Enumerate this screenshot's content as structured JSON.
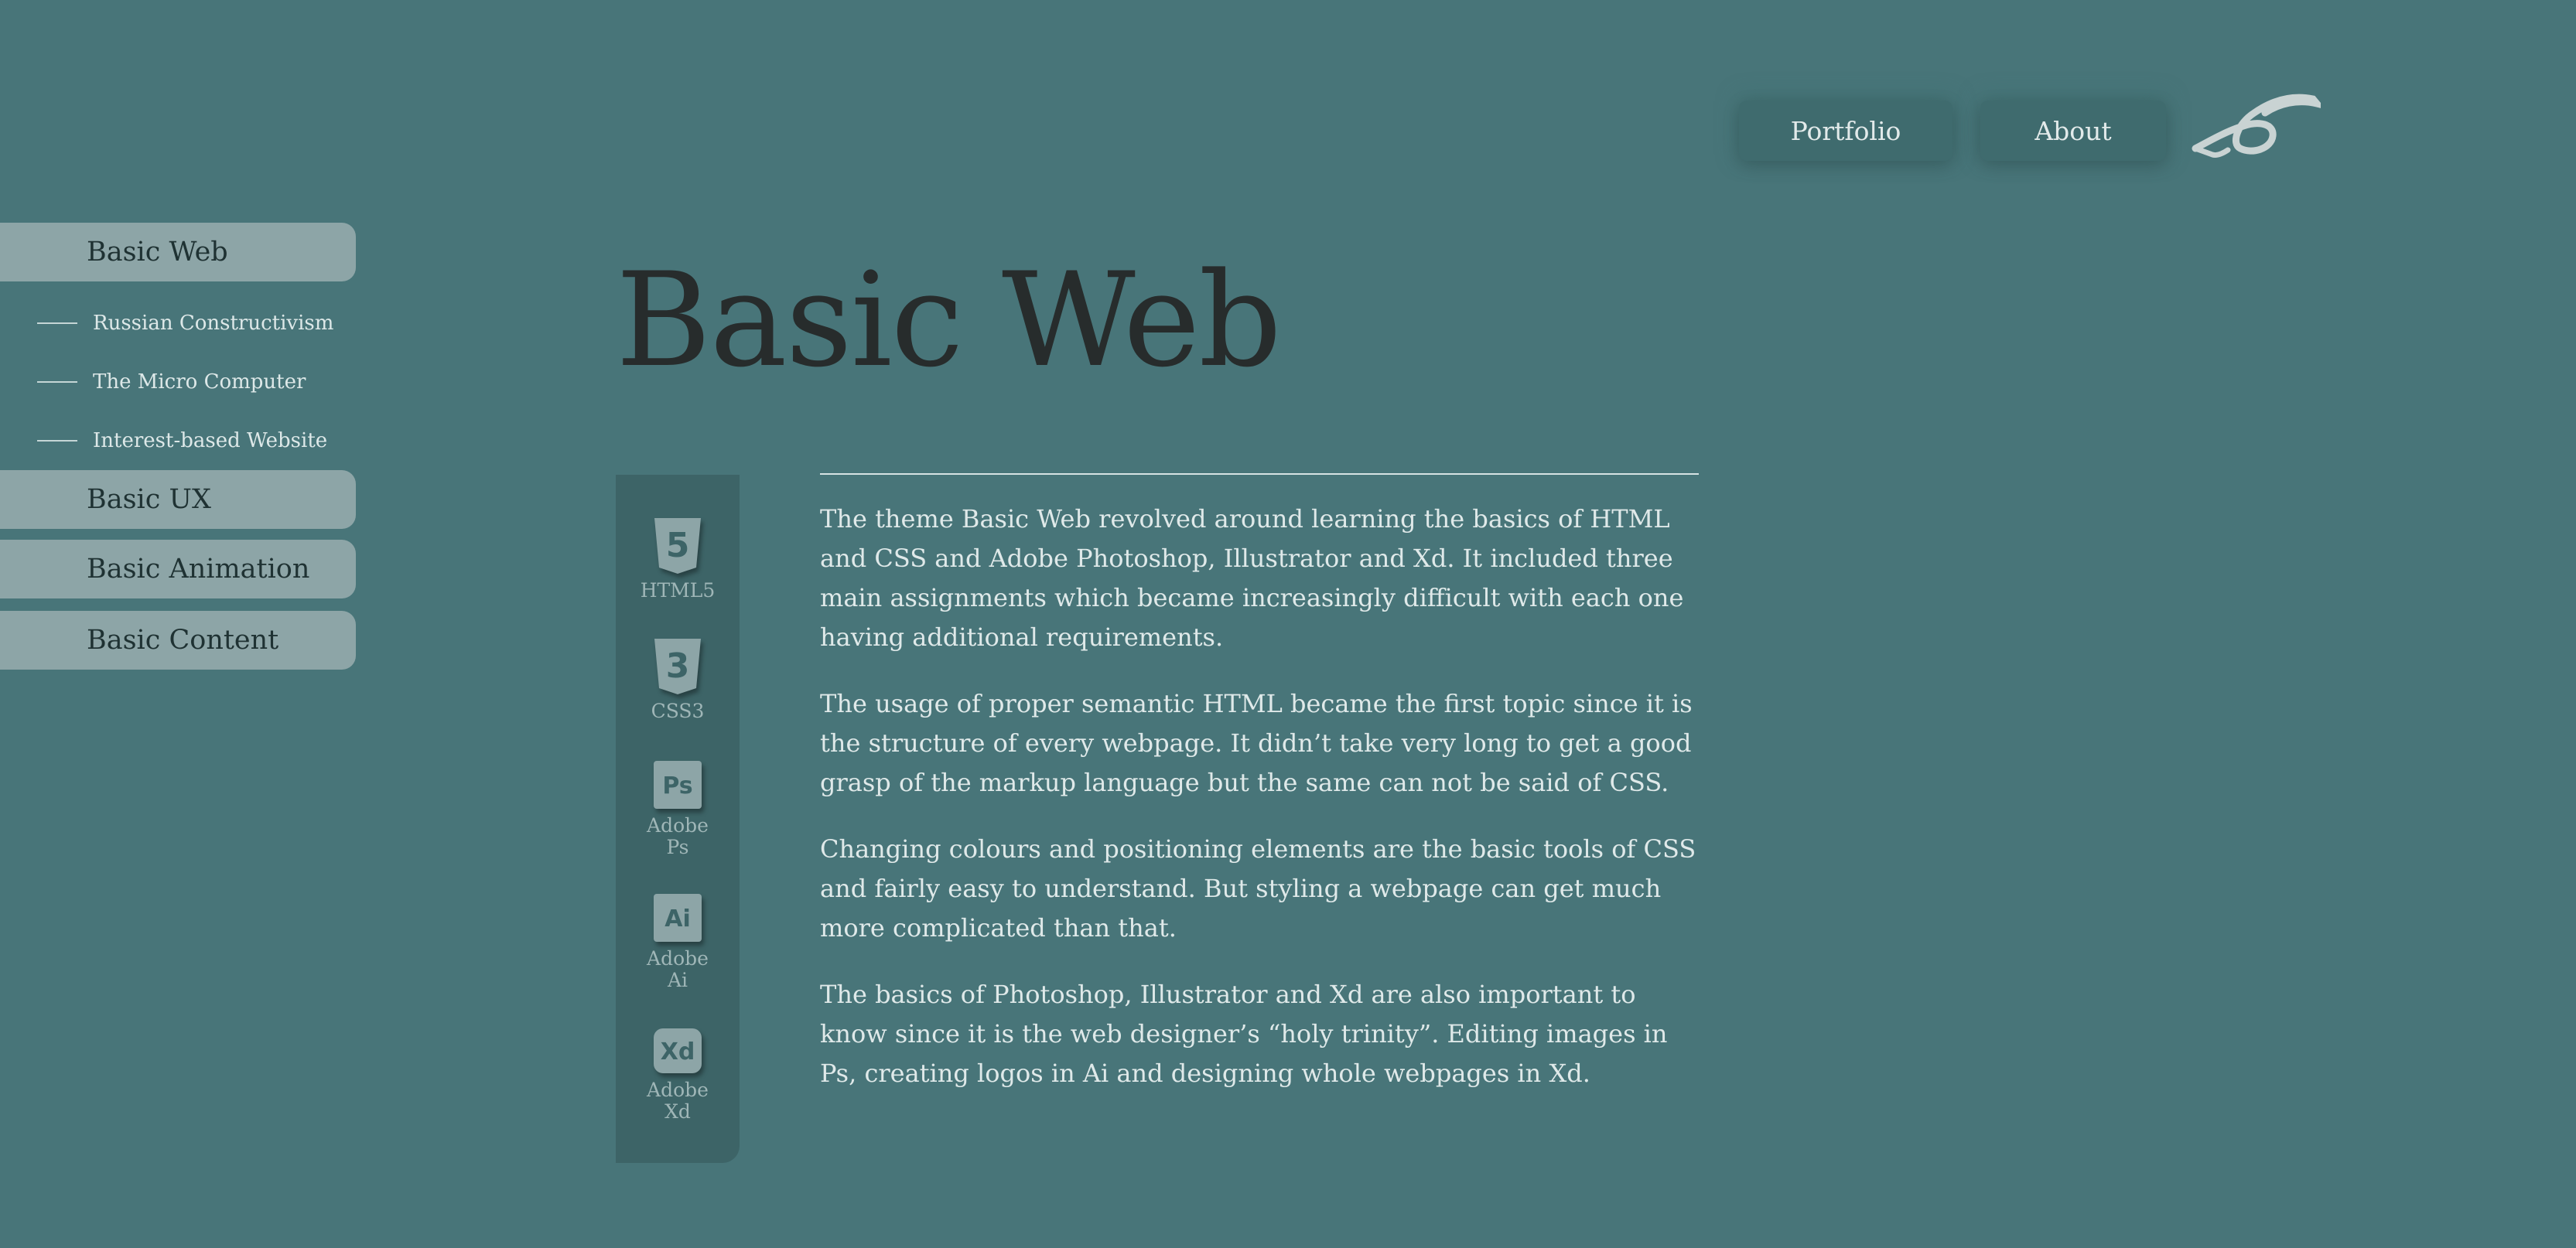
{
  "header": {
    "nav": [
      {
        "label": "Portfolio"
      },
      {
        "label": "About"
      }
    ]
  },
  "sidebar": {
    "sections": [
      {
        "label": "Basic Web",
        "subitems": [
          "Russian Constructivism",
          "The Micro Computer",
          "Interest-based Website"
        ]
      },
      {
        "label": "Basic UX"
      },
      {
        "label": "Basic Animation"
      },
      {
        "label": "Basic Content"
      }
    ]
  },
  "main": {
    "title": "Basic Web",
    "tools": [
      {
        "icon": "html5-icon",
        "glyph": "5",
        "label": "HTML5"
      },
      {
        "icon": "css3-icon",
        "glyph": "3",
        "label": "CSS3"
      },
      {
        "icon": "photoshop-icon",
        "glyph": "Ps",
        "label": "Adobe\nPs"
      },
      {
        "icon": "illustrator-icon",
        "glyph": "Ai",
        "label": "Adobe\nAi"
      },
      {
        "icon": "xd-icon",
        "glyph": "Xd",
        "label": "Adobe\nXd"
      }
    ],
    "paragraphs": [
      "The theme Basic Web revolved around learning the basics of HTML and CSS and Adobe Photoshop, Illustrator and Xd. It included three main assignments which became increasingly difficult with each one having additional requirements.",
      "The usage of proper semantic HTML became the first topic since it is the structure of every webpage. It didn’t take very long to get a good grasp of the markup language but the same can not be said of CSS.",
      "Changing colours and positioning elements are the basic tools of CSS and fairly easy to understand. But styling a webpage can get much more complicated than that.",
      "The basics of Photoshop, Illustrator and Xd are also important to know since it is the web designer’s “holy trinity”. Editing images in Ps, creating logos in Ai and designing whole webpages in Xd."
    ]
  },
  "colors": {
    "background": "#487579",
    "sidebar_item": "#8da5a7",
    "panel": "#3d6467",
    "title": "#272c2c"
  }
}
